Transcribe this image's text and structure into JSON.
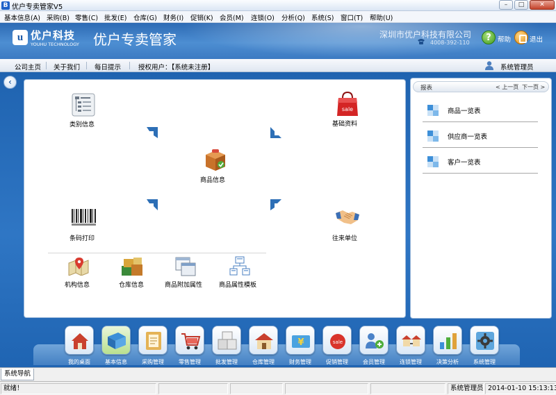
{
  "window": {
    "title": "优户专卖管家V5",
    "icon_letter": "B"
  },
  "menu": [
    "基本信息(A)",
    "采购(B)",
    "零售(C)",
    "批发(E)",
    "仓库(G)",
    "财务(I)",
    "促销(K)",
    "会员(M)",
    "连锁(O)",
    "分析(Q)",
    "系统(S)",
    "窗口(T)",
    "帮助(U)"
  ],
  "header": {
    "logo_cn": "优户科技",
    "logo_en": "YOUHU TECHNOLOGY",
    "product": "优户专卖管家",
    "company": "深圳市优户科技有限公司",
    "hotline": "4008-392-110",
    "help": "帮助",
    "exit": "退出"
  },
  "nav": {
    "links": [
      "公司主页",
      "关于我们",
      "每日提示"
    ],
    "license": "授权用户：【系统未注册】",
    "user": "系统管理员"
  },
  "panel": {
    "top_items": [
      {
        "label": "类别信息",
        "icon": "category-tree-icon"
      },
      {
        "label": "基础资料",
        "icon": "shopping-bag-icon"
      },
      {
        "label": "商品信息",
        "icon": "product-box-icon"
      },
      {
        "label": "条码打印",
        "icon": "barcode-icon"
      },
      {
        "label": "往来单位",
        "icon": "handshake-icon"
      }
    ],
    "bottom_items": [
      {
        "label": "机构信息",
        "icon": "map-pin-icon"
      },
      {
        "label": "仓库信息",
        "icon": "warehouse-icon"
      },
      {
        "label": "商品附加属性",
        "icon": "windows-stack-icon"
      },
      {
        "label": "商品属性模板",
        "icon": "template-tree-icon"
      }
    ]
  },
  "reports": {
    "title": "报表",
    "prev": "< 上一页",
    "next": "下一页 >",
    "items": [
      "商品一览表",
      "供应商一览表",
      "客户一览表"
    ]
  },
  "dock": [
    {
      "label": "我的桌面",
      "icon": "home-icon"
    },
    {
      "label": "基本信息",
      "icon": "books-icon",
      "active": true
    },
    {
      "label": "采购管理",
      "icon": "notebook-icon"
    },
    {
      "label": "零售管理",
      "icon": "cart-icon"
    },
    {
      "label": "批发管理",
      "icon": "boxes-icon"
    },
    {
      "label": "仓库管理",
      "icon": "warehouse-house-icon"
    },
    {
      "label": "财务管理",
      "icon": "finance-icon"
    },
    {
      "label": "促销管理",
      "icon": "sale-tag-icon"
    },
    {
      "label": "会员管理",
      "icon": "members-icon"
    },
    {
      "label": "连锁管理",
      "icon": "chain-store-icon"
    },
    {
      "label": "决策分析",
      "icon": "bar-chart-icon"
    },
    {
      "label": "系统管理",
      "icon": "settings-gear-icon"
    }
  ],
  "tab": "系统导航",
  "status": {
    "ready": "就绪！",
    "user": "系统管理员",
    "datetime": "2014-01-10 15:13:13"
  },
  "colors": {
    "header": "#3c7ac2",
    "workspace": "#2f76c4",
    "panel_border": "#9bb8da"
  }
}
